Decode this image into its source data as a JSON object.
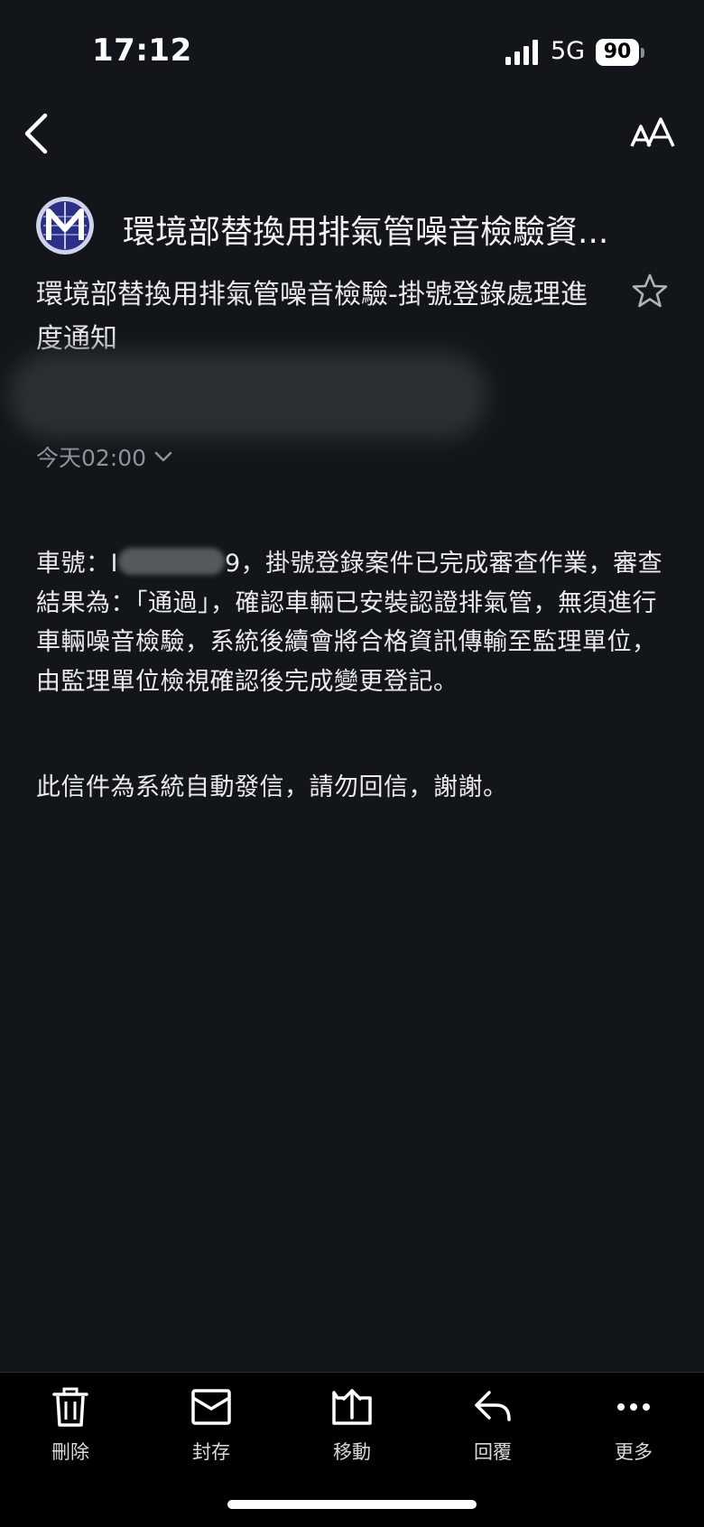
{
  "status_bar": {
    "time": "17:12",
    "network": "5G",
    "battery": "90"
  },
  "email": {
    "sender_name": "環境部替換用排氣管噪音檢驗資...",
    "subject": "環境部替換用排氣管噪音檢驗-掛號登錄處理進度通知",
    "date": "今天02:00",
    "body_prefix": "車號：",
    "body_plate_partial_start": "I",
    "body_plate_partial_end": "9",
    "body_main": "，掛號登錄案件已完成審查作業，審查結果為：「通過」，確認車輛已安裝認證排氣管，無須進行車輛噪音檢驗，系統後續會將合格資訊傳輸至監理單位，由監理單位檢視確認後完成變更登記。",
    "body_note": "此信件為系統自動發信，請勿回信，謝謝。"
  },
  "toolbar": {
    "delete_label": "刪除",
    "archive_label": "封存",
    "move_label": "移動",
    "reply_label": "回覆",
    "more_label": "更多"
  }
}
